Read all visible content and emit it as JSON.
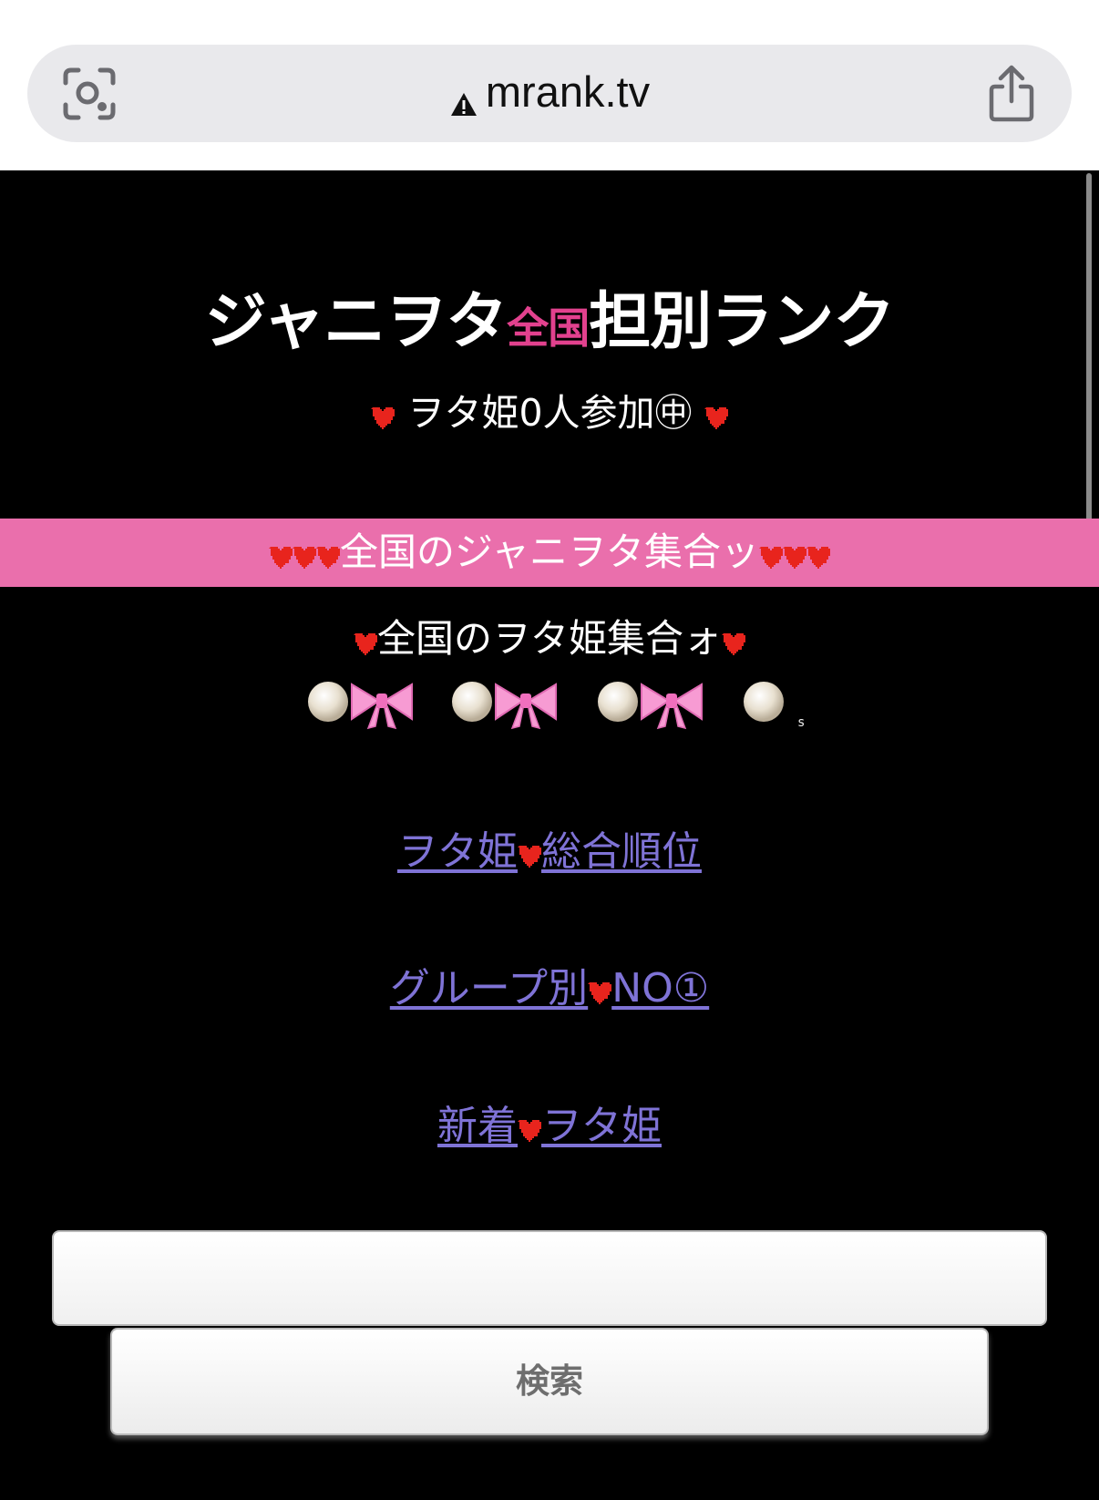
{
  "browser": {
    "url": "mrank.tv",
    "icons": [
      "visual-lookup-icon",
      "warning-icon",
      "share-icon"
    ]
  },
  "header": {
    "title_part1": "ジャニヲタ",
    "title_highlight": "全国",
    "title_part2": "担別ランク",
    "participants": "ヲタ姫0人参加㊥"
  },
  "banner": {
    "text": "全国のジャニヲタ集合ッ"
  },
  "gather": {
    "text": "全国のヲタ姫集合ォ",
    "deco_mark": "s"
  },
  "nav": {
    "links": [
      {
        "left": "ヲタ姫",
        "right": "総合順位"
      },
      {
        "left": "グループ別",
        "right": "NO①"
      },
      {
        "left": "新着",
        "right": "ヲタ姫"
      }
    ]
  },
  "search": {
    "input_value": "",
    "button_label": "検索"
  },
  "colors": {
    "page_bg": "#000000",
    "banner_bg": "#ea6fac",
    "title_accent": "#e2418e",
    "heart": "#e8241d",
    "link": "#7f73d6"
  }
}
